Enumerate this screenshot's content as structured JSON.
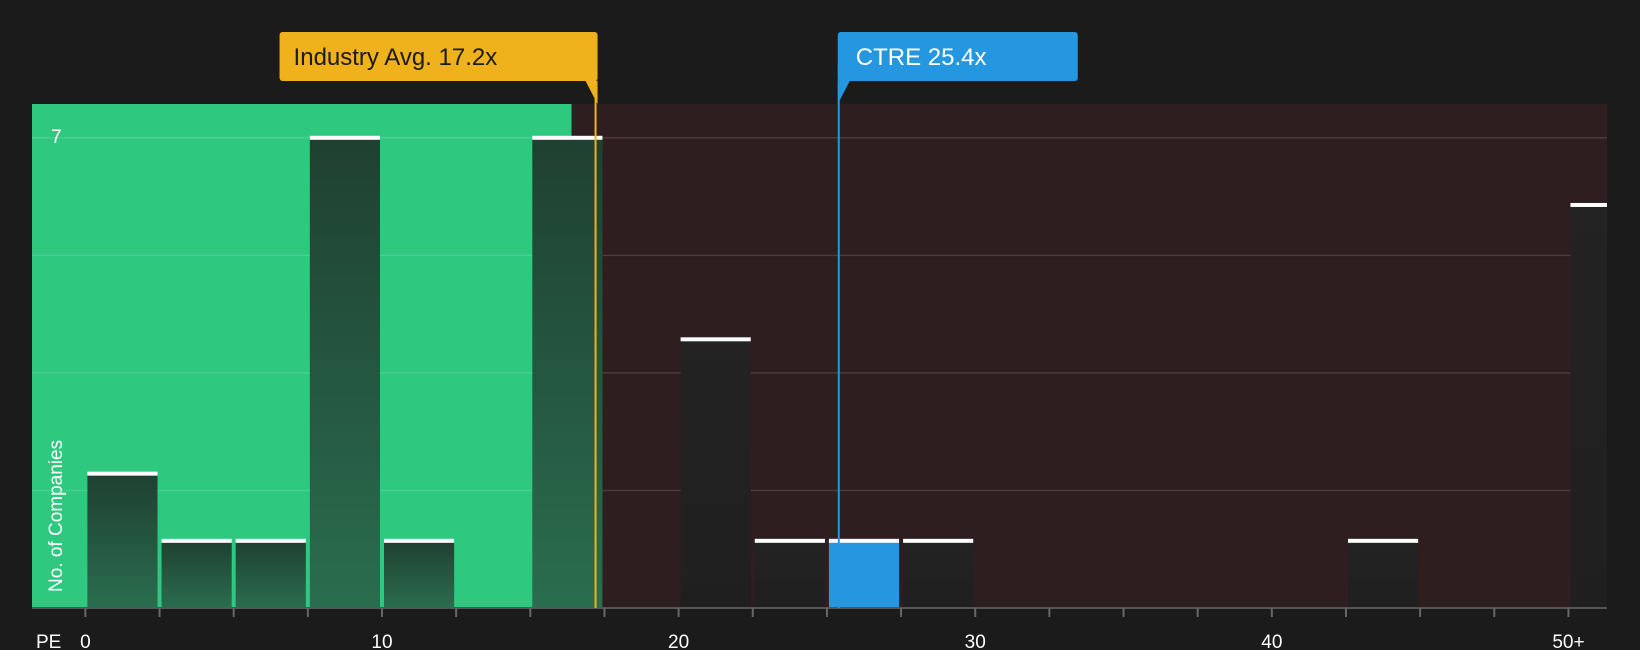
{
  "chart_data": {
    "type": "bar",
    "title": "",
    "xlabel": "PE",
    "ylabel": "No. of Companies",
    "x_tick_labels": [
      "0",
      "10",
      "20",
      "30",
      "40",
      "50+"
    ],
    "x_ticks": [
      0,
      10,
      20,
      30,
      40,
      50
    ],
    "xlim": [
      -1.8,
      51.3
    ],
    "ylim": [
      0,
      7.25
    ],
    "y_top_label": "7",
    "bin_width": 2.5,
    "bars": [
      {
        "x_start": 0,
        "value": 2
      },
      {
        "x_start": 2.5,
        "value": 1
      },
      {
        "x_start": 5,
        "value": 1
      },
      {
        "x_start": 7.5,
        "value": 7
      },
      {
        "x_start": 10,
        "value": 1
      },
      {
        "x_start": 15,
        "value": 7
      },
      {
        "x_start": 20,
        "value": 4
      },
      {
        "x_start": 22.5,
        "value": 1
      },
      {
        "x_start": 25,
        "value": 1,
        "highlight": true
      },
      {
        "x_start": 27.5,
        "value": 1
      },
      {
        "x_start": 42.5,
        "value": 1
      },
      {
        "x_start": 50,
        "value": 6
      }
    ],
    "industry_avg": {
      "value": 17.2,
      "label": "Industry Avg. 17.2x"
    },
    "company": {
      "name": "CTRE",
      "value": 25.4,
      "label": "CTRE 25.4x"
    },
    "colors": {
      "background": "#1b1b1b",
      "fair_zone": "#2ec87f",
      "over_zone": "#2e1e1f",
      "bar_dark": "#222222",
      "bar_highlight": "#2596e0",
      "avg_callout": "#efb21c",
      "company_callout": "#2596e0",
      "cap": "#ffffff"
    }
  }
}
